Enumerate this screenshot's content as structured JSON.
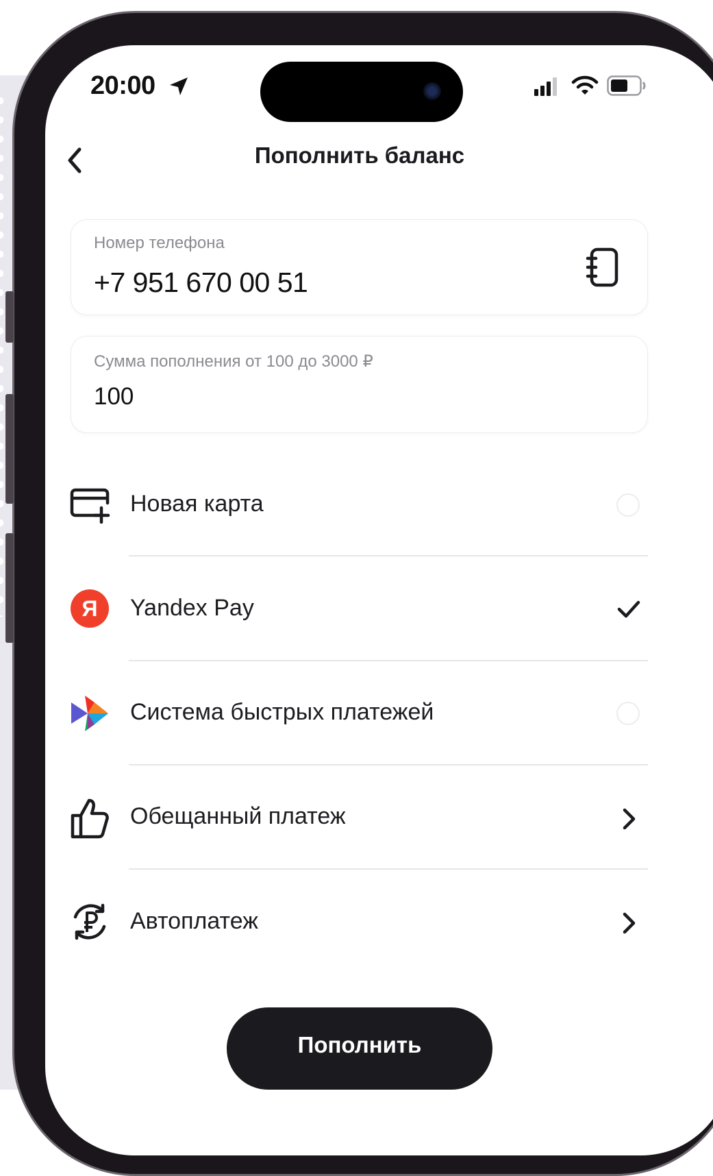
{
  "status_bar": {
    "time": "20:00"
  },
  "header": {
    "title": "Пополнить баланс"
  },
  "phone_field": {
    "label": "Номер телефона",
    "value": "+7 951  670 00 51"
  },
  "amount_field": {
    "label": "Сумма пополнения от 100 до 3000 ₽",
    "value": "100"
  },
  "payment_methods": [
    {
      "label": "Новая карта",
      "icon": "add-card-icon",
      "state": "unselected"
    },
    {
      "label": "Yandex Pay",
      "icon": "yandex-pay-logo",
      "logo_text": "Я",
      "logo_color": "#f0402c",
      "state": "selected"
    },
    {
      "label": "Система быстрых платежей",
      "icon": "sbp-logo",
      "state": "unselected"
    }
  ],
  "options": [
    {
      "label": "Обещанный платеж",
      "icon": "thumbs-up-icon"
    },
    {
      "label": "Автоплатеж",
      "icon": "ruble-cycle-icon"
    }
  ],
  "submit": {
    "label": "Пополнить"
  },
  "colors": {
    "button_bg": "#1b1b1f",
    "divider": "#e6e6ea",
    "field_label": "#8a8a90"
  }
}
